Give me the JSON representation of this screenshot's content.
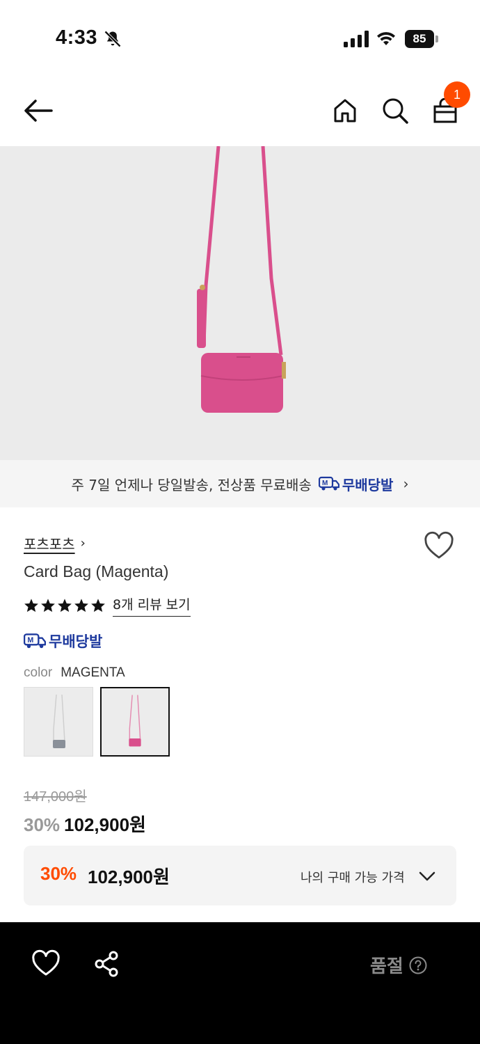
{
  "status": {
    "time": "4:33",
    "battery": "85",
    "icons": [
      "bell-slash-icon",
      "signal-icon",
      "wifi-icon",
      "battery-icon"
    ]
  },
  "nav": {
    "icons": [
      "back-arrow-icon",
      "home-icon",
      "search-icon",
      "shopping-bag-icon"
    ],
    "cart_count": "1"
  },
  "promo": {
    "text": "주 7일 언제나 당일발송, 전상품 무료배송",
    "badge": "무배당발",
    "chevron": "›"
  },
  "product": {
    "brand": "포츠포츠",
    "brand_chevron": "›",
    "name": "Card Bag (Magenta)",
    "rating_stars": 5,
    "review_link": "8개 리뷰 보기",
    "delivery_badge": "무배당발",
    "color_label": "color",
    "color_value": "MAGENTA",
    "swatches": [
      {
        "color": "gray",
        "selected": false
      },
      {
        "color": "magenta",
        "selected": true
      }
    ],
    "original_price": "147,000원",
    "discount_pct": "30%",
    "sale_price": "102,900원"
  },
  "my_price": {
    "discount_pct": "30%",
    "price": "102,900원",
    "label": "나의 구매 가능 가격"
  },
  "bottom_bar": {
    "status": "품절",
    "icons": [
      "heart-icon",
      "share-icon",
      "help-icon"
    ]
  },
  "colors": {
    "accent": "#ff4b00",
    "badge_blue": "#1e3a9e",
    "bag_magenta": "#d94f8c",
    "bottom_bar": "#000000"
  }
}
